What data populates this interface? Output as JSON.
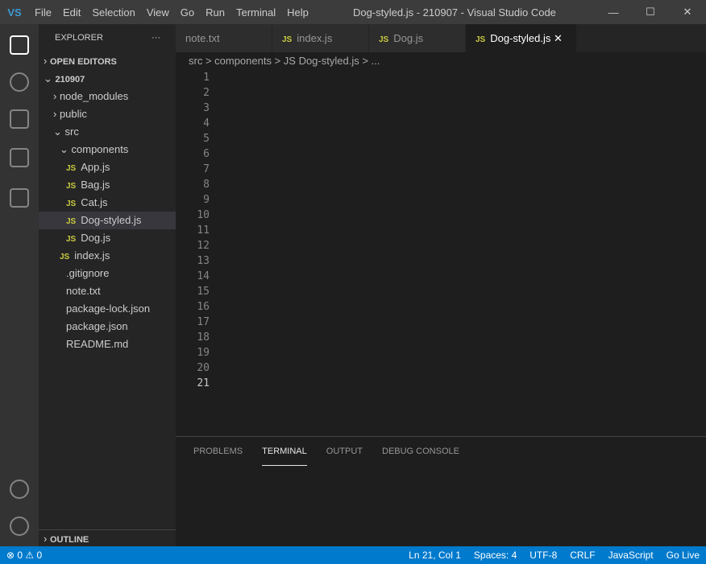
{
  "titlebar": {
    "logo": "VS",
    "title": "Dog-styled.js - 210907 - Visual Studio Code",
    "menu": [
      "File",
      "Edit",
      "Selection",
      "View",
      "Go",
      "Run",
      "Terminal",
      "Help"
    ],
    "min": "—",
    "max": "☐",
    "close": "✕"
  },
  "explorer": {
    "header": "EXPLORER",
    "more": "···",
    "open_editors": "OPEN EDITORS",
    "outline": "OUTLINE",
    "folder": "210907",
    "node_modules": "node_modules",
    "public": "public",
    "src": "src",
    "components": "components",
    "app": "App.js",
    "bag": "Bag.js",
    "cat": "Cat.js",
    "dog_styled": "Dog-styled.js",
    "dog": "Dog.js",
    "index": "index.js",
    "gitignore": ".gitignore",
    "note": "note.txt",
    "lock": "package-lock.json",
    "pkg": "package.json",
    "readme": "README.md"
  },
  "tabs": {
    "t1": "note.txt",
    "t2": "index.js",
    "t3": "Dog.js",
    "t4": "Dog-styled.js",
    "js": "JS",
    "close": "✕"
  },
  "breadcrumb": "src > components > JS Dog-styled.js > ...",
  "editor": {
    "lines": [
      "1",
      "2",
      "3",
      "4",
      "5",
      "6",
      "7",
      "8",
      "9",
      "10",
      "11",
      "12",
      "13",
      "14",
      "15",
      "16",
      "17",
      "18",
      "19",
      "20",
      "21"
    ]
  },
  "panel": {
    "problems": "PROBLEMS",
    "terminal": "TERMINAL",
    "output": "OUTPUT",
    "debug": "DEBUG CONSOLE"
  },
  "status": {
    "errors": "⊗ 0 ⚠ 0",
    "pos": "Ln 21, Col 1",
    "spaces": "Spaces: 4",
    "enc": "UTF-8",
    "eol": "CRLF",
    "lang": "JavaScript",
    "live": "Go Live"
  }
}
